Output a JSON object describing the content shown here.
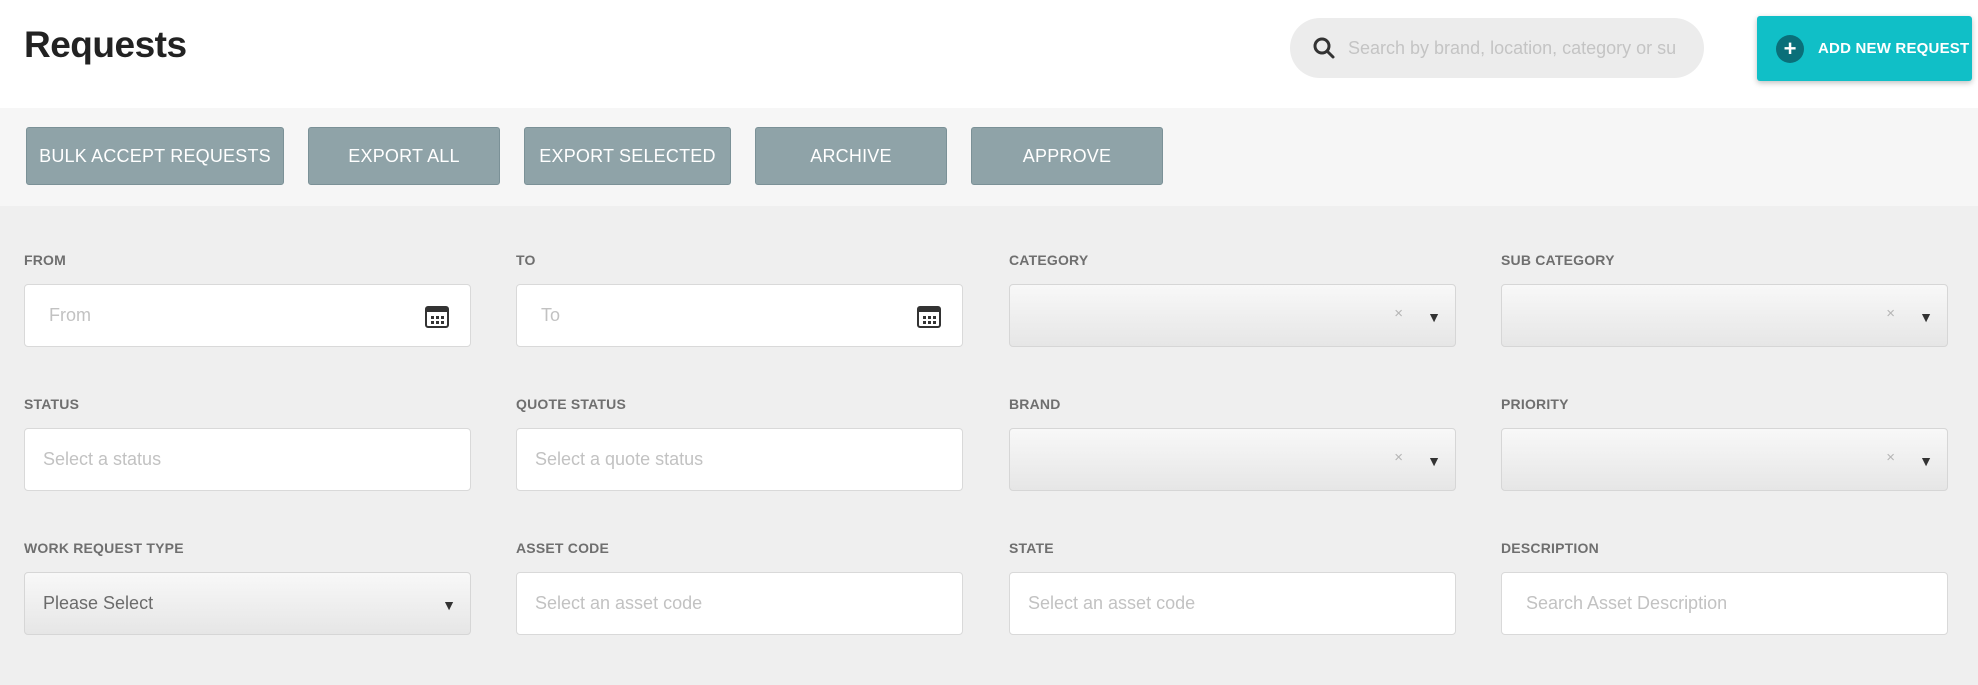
{
  "header": {
    "title": "Requests",
    "search_placeholder": "Search by brand, location, category or su",
    "add_button_label": "ADD NEW REQUEST"
  },
  "toolbar": {
    "bulk_accept": "BULK ACCEPT REQUESTS",
    "export_all": "EXPORT ALL",
    "export_selected": "EXPORT SELECTED",
    "archive": "ARCHIVE",
    "approve": "APPROVE"
  },
  "filters": {
    "from": {
      "label": "FROM",
      "placeholder": "From"
    },
    "to": {
      "label": "TO",
      "placeholder": "To"
    },
    "category": {
      "label": "CATEGORY",
      "clear": "×"
    },
    "sub_category": {
      "label": "SUB CATEGORY",
      "clear": "×"
    },
    "status": {
      "label": "STATUS",
      "placeholder": "Select a status"
    },
    "quote_status": {
      "label": "QUOTE STATUS",
      "placeholder": "Select a quote status"
    },
    "brand": {
      "label": "BRAND",
      "clear": "×"
    },
    "priority": {
      "label": "PRIORITY",
      "clear": "×"
    },
    "work_request_type": {
      "label": "WORK REQUEST TYPE",
      "value": "Please Select"
    },
    "asset_code": {
      "label": "ASSET CODE",
      "placeholder": "Select an asset code"
    },
    "state": {
      "label": "STATE",
      "placeholder": "Select an asset code"
    },
    "description": {
      "label": "DESCRIPTION",
      "placeholder": "Search Asset Description"
    }
  },
  "icons": {
    "search": "search-icon",
    "add": "plus-circle-icon",
    "calendar": "calendar-icon",
    "dropdown": "caret-down-icon",
    "clear": "clear-x-icon"
  },
  "colors": {
    "accent": "#10bfc7",
    "accent_dark": "#0a6f79",
    "toolbar_button": "#8fa3a8",
    "page_bg": "#efefef"
  }
}
